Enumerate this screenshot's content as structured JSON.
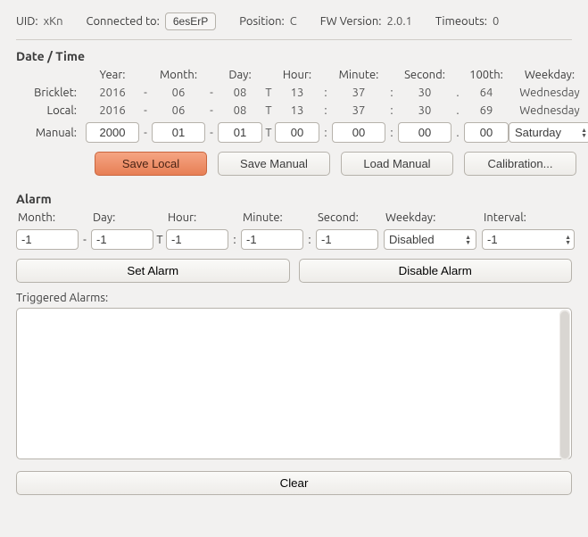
{
  "header": {
    "uid_label": "UID:",
    "uid_value": "xKn",
    "connected_label": "Connected to:",
    "connected_value": "6esErP",
    "position_label": "Position:",
    "position_value": "C",
    "fw_label": "FW Version:",
    "fw_value": "2.0.1",
    "timeouts_label": "Timeouts:",
    "timeouts_value": "0"
  },
  "datetime": {
    "section_title": "Date / Time",
    "columns": {
      "year": "Year:",
      "month": "Month:",
      "day": "Day:",
      "hour": "Hour:",
      "minute": "Minute:",
      "second": "Second:",
      "hundredth": "100th:",
      "weekday": "Weekday:"
    },
    "rowlabels": {
      "bricklet": "Bricklet:",
      "local": "Local:",
      "manual": "Manual:"
    },
    "sep_dash": "-",
    "sep_T": "T",
    "sep_colon": ":",
    "sep_dot": ".",
    "bricklet": {
      "year": "2016",
      "month": "06",
      "day": "08",
      "hour": "13",
      "minute": "37",
      "second": "30",
      "hundredth": "64",
      "weekday": "Wednesday"
    },
    "local": {
      "year": "2016",
      "month": "06",
      "day": "08",
      "hour": "13",
      "minute": "37",
      "second": "30",
      "hundredth": "69",
      "weekday": "Wednesday"
    },
    "manual": {
      "year": "2000",
      "month": "01",
      "day": "01",
      "hour": "00",
      "minute": "00",
      "second": "00",
      "hundredth": "00",
      "weekday": "Saturday"
    },
    "buttons": {
      "save_local": "Save Local",
      "save_manual": "Save Manual",
      "load_manual": "Load Manual",
      "calibration": "Calibration..."
    }
  },
  "alarm": {
    "section_title": "Alarm",
    "headers": {
      "month": "Month:",
      "day": "Day:",
      "hour": "Hour:",
      "minute": "Minute:",
      "second": "Second:",
      "weekday": "Weekday:",
      "interval": "Interval:"
    },
    "sep_dash": "-",
    "sep_T": "T",
    "sep_colon": ":",
    "values": {
      "month": "-1",
      "day": "-1",
      "hour": "-1",
      "minute": "-1",
      "second": "-1",
      "weekday": "Disabled",
      "interval": "-1"
    },
    "buttons": {
      "set": "Set Alarm",
      "disable": "Disable Alarm",
      "clear": "Clear"
    },
    "triggered_label": "Triggered Alarms:",
    "triggered_value": ""
  }
}
